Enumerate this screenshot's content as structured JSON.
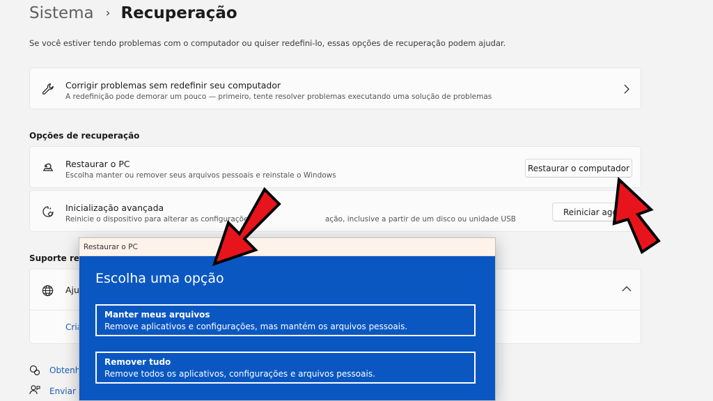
{
  "breadcrumb": {
    "parent": "Sistema",
    "separator": "›",
    "current": "Recuperação"
  },
  "description": "Se você estiver tendo problemas com o computador ou quiser redefini-lo, essas opções de recuperação podem ajudar.",
  "fix_card": {
    "title": "Corrigir problemas sem redefinir seu computador",
    "subtitle": "A redefinição pode demorar um pouco — primeiro, tente resolver problemas executando uma solução de problemas"
  },
  "recovery_section": {
    "heading": "Opções de recuperação",
    "reset": {
      "title": "Restaurar o PC",
      "subtitle": "Escolha manter ou remover seus arquivos pessoais e reinstale o Windows",
      "button": "Restaurar o computador"
    },
    "advanced": {
      "title": "Inicialização avançada",
      "subtitle_left": "Reinicie o dispositivo para alterar as configurações",
      "subtitle_right": "ação, inclusive a partir de um disco ou unidade USB",
      "button": "Reiniciar agora"
    }
  },
  "support_section": {
    "heading": "Suporte relac",
    "item_label": "Aju",
    "link": "Cria"
  },
  "footer_links": {
    "get_help": "Obtenha",
    "send_feedback": "Enviar c"
  },
  "dialog": {
    "title": "Restaurar o PC",
    "heading": "Escolha uma opção",
    "options": [
      {
        "title": "Manter meus arquivos",
        "description": "Remove aplicativos e configurações, mas mantém os arquivos pessoais."
      },
      {
        "title": "Remover tudo",
        "description": "Remove todos os aplicativos, configurações e arquivos pessoais."
      }
    ]
  },
  "colors": {
    "dialog_blue": "#0a57c2",
    "arrow_red": "#e8141c",
    "page_bg": "#f3f3f3"
  }
}
